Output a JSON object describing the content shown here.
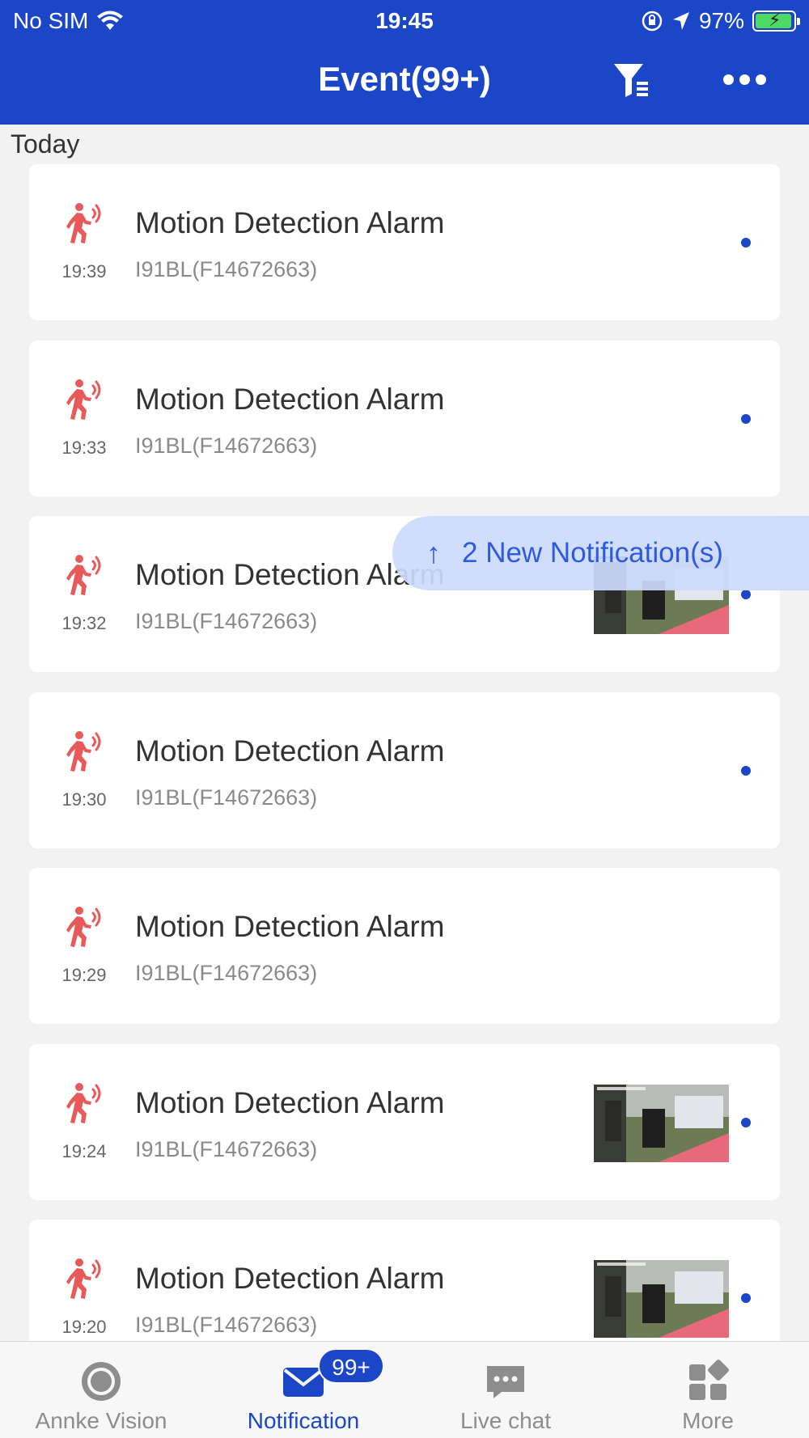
{
  "status_bar": {
    "carrier": "No SIM",
    "time": "19:45",
    "battery": "97%"
  },
  "header": {
    "title": "Event(99+)",
    "filter_icon": "filter-icon",
    "more_icon": "more-icon"
  },
  "section": {
    "label": "Today"
  },
  "events": [
    {
      "time": "19:39",
      "title": "Motion Detection Alarm",
      "device": "I91BL(F14672663)",
      "has_thumbnail": false,
      "unread": true
    },
    {
      "time": "19:33",
      "title": "Motion Detection Alarm",
      "device": "I91BL(F14672663)",
      "has_thumbnail": false,
      "unread": true
    },
    {
      "time": "19:32",
      "title": "Motion Detection Alarm",
      "device": "I91BL(F14672663)",
      "has_thumbnail": true,
      "unread": true
    },
    {
      "time": "19:30",
      "title": "Motion Detection Alarm",
      "device": "I91BL(F14672663)",
      "has_thumbnail": false,
      "unread": true
    },
    {
      "time": "19:29",
      "title": "Motion Detection Alarm",
      "device": "I91BL(F14672663)",
      "has_thumbnail": false,
      "unread": false
    },
    {
      "time": "19:24",
      "title": "Motion Detection Alarm",
      "device": "I91BL(F14672663)",
      "has_thumbnail": true,
      "unread": true
    },
    {
      "time": "19:20",
      "title": "Motion Detection Alarm",
      "device": "I91BL(F14672663)",
      "has_thumbnail": true,
      "unread": true
    }
  ],
  "toast": {
    "label": "2 New Notification(s)",
    "icon": "arrow-up-icon"
  },
  "tabbar": {
    "tabs": [
      {
        "label": "Annke Vision",
        "icon": "camera-lens-icon",
        "active": false
      },
      {
        "label": "Notification",
        "icon": "envelope-icon",
        "active": true,
        "badge": "99+"
      },
      {
        "label": "Live chat",
        "icon": "chat-bubble-icon",
        "active": false
      },
      {
        "label": "More",
        "icon": "grid-apps-icon",
        "active": false
      }
    ]
  },
  "colors": {
    "primary": "#1b46c8",
    "alarm": "#e85a5a",
    "background": "#f2f2f2"
  }
}
